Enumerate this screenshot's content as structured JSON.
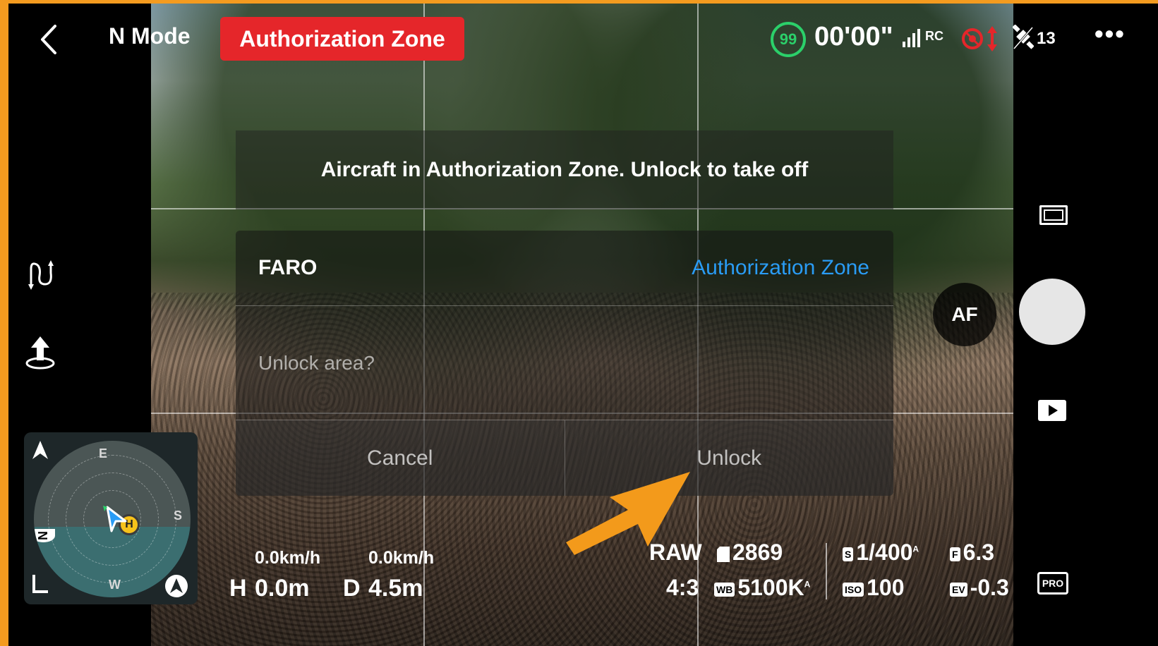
{
  "header": {
    "back_icon": "chevron-left-icon",
    "mode": "N Mode",
    "zone_badge": "Authorization Zone",
    "battery": "99",
    "flight_time": "00'00\"",
    "rc_label": "RC",
    "gps_count": "13",
    "more_label": "•••"
  },
  "dialog": {
    "title": "Aircraft in Authorization Zone. Unlock to take off",
    "zone_name": "FARO",
    "zone_type": "Authorization Zone",
    "question": "Unlock area?",
    "cancel_label": "Cancel",
    "unlock_label": "Unlock"
  },
  "map": {
    "east": "E",
    "south": "S",
    "west": "W",
    "north": "N",
    "home": "H"
  },
  "telemetry": {
    "h_speed": "0.0km/h",
    "v_speed": "0.0km/h",
    "height_label": "H",
    "height_value": "0.0m",
    "distance_label": "D",
    "distance_value": "4.5m"
  },
  "camera": {
    "format": "RAW",
    "shots_remaining": "2869",
    "aspect_ratio": "4:3",
    "wb_icon": "WB",
    "white_balance": "5100K",
    "shutter_icon": "S",
    "shutter": "1/400",
    "aperture_icon": "F",
    "aperture": "6.3",
    "iso_icon": "ISO",
    "iso": "100",
    "ev_icon": "EV",
    "ev": "-0.3",
    "auto_mark": "A"
  },
  "controls": {
    "af_label": "AF",
    "pro_label": "PRO"
  },
  "colors": {
    "frame": "#f49b1f",
    "zone_badge": "#e5262a",
    "battery_ring": "#2bd06a",
    "zone_type_text": "#2a9cf5",
    "annotation_arrow": "#f39a1b"
  }
}
